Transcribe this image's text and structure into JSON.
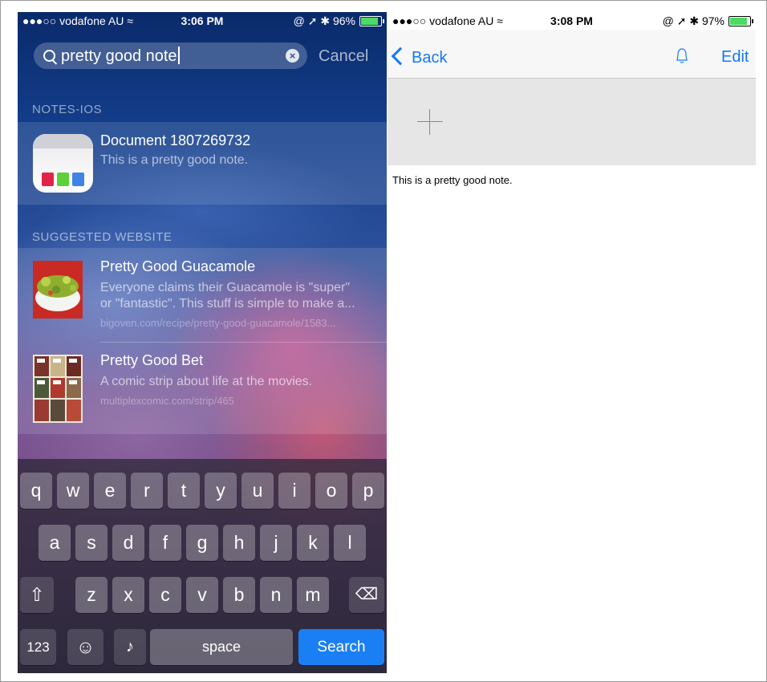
{
  "left": {
    "status": {
      "carrier": "●●●○○ vodafone AU ≈",
      "time": "3:06 PM",
      "icons": "@ ➚ ✱ 96%",
      "battery_level": 0.96
    },
    "search": {
      "query": "pretty good note",
      "cancel": "Cancel"
    },
    "notes_section": {
      "header": "NOTES-IOS",
      "title": "Document 1807269732",
      "subtitle": "This is a pretty good note."
    },
    "web_section": {
      "header": "SUGGESTED WEBSITE",
      "items": [
        {
          "title": "Pretty Good Guacamole",
          "line1": "Everyone claims their Guacamole is \"super\"",
          "line2": "or \"fantastic\". This stuff is simple to make a...",
          "url": "bigoven.com/recipe/pretty-good-guacamole/1583..."
        },
        {
          "title": "Pretty Good Bet",
          "line1": "A comic strip about life at the movies.",
          "url": "multiplexcomic.com/strip/465"
        }
      ]
    },
    "keyboard": {
      "row1": [
        "q",
        "w",
        "e",
        "r",
        "t",
        "y",
        "u",
        "i",
        "o",
        "p"
      ],
      "row2": [
        "a",
        "s",
        "d",
        "f",
        "g",
        "h",
        "j",
        "k",
        "l"
      ],
      "row3": [
        "z",
        "x",
        "c",
        "v",
        "b",
        "n",
        "m"
      ],
      "num": "123",
      "space": "space",
      "search": "Search"
    }
  },
  "right": {
    "status": {
      "carrier": "●●●○○ vodafone AU ≈",
      "time": "3:08 PM",
      "icons": "@ ➚ ✱ 97%",
      "battery_level": 0.97
    },
    "nav": {
      "back": "Back",
      "edit": "Edit"
    },
    "note_text": "This is a pretty good note."
  },
  "colors": {
    "ios_blue": "#1479f6",
    "search_key": "#1a7ff5",
    "battery_green": "#4cd964"
  }
}
